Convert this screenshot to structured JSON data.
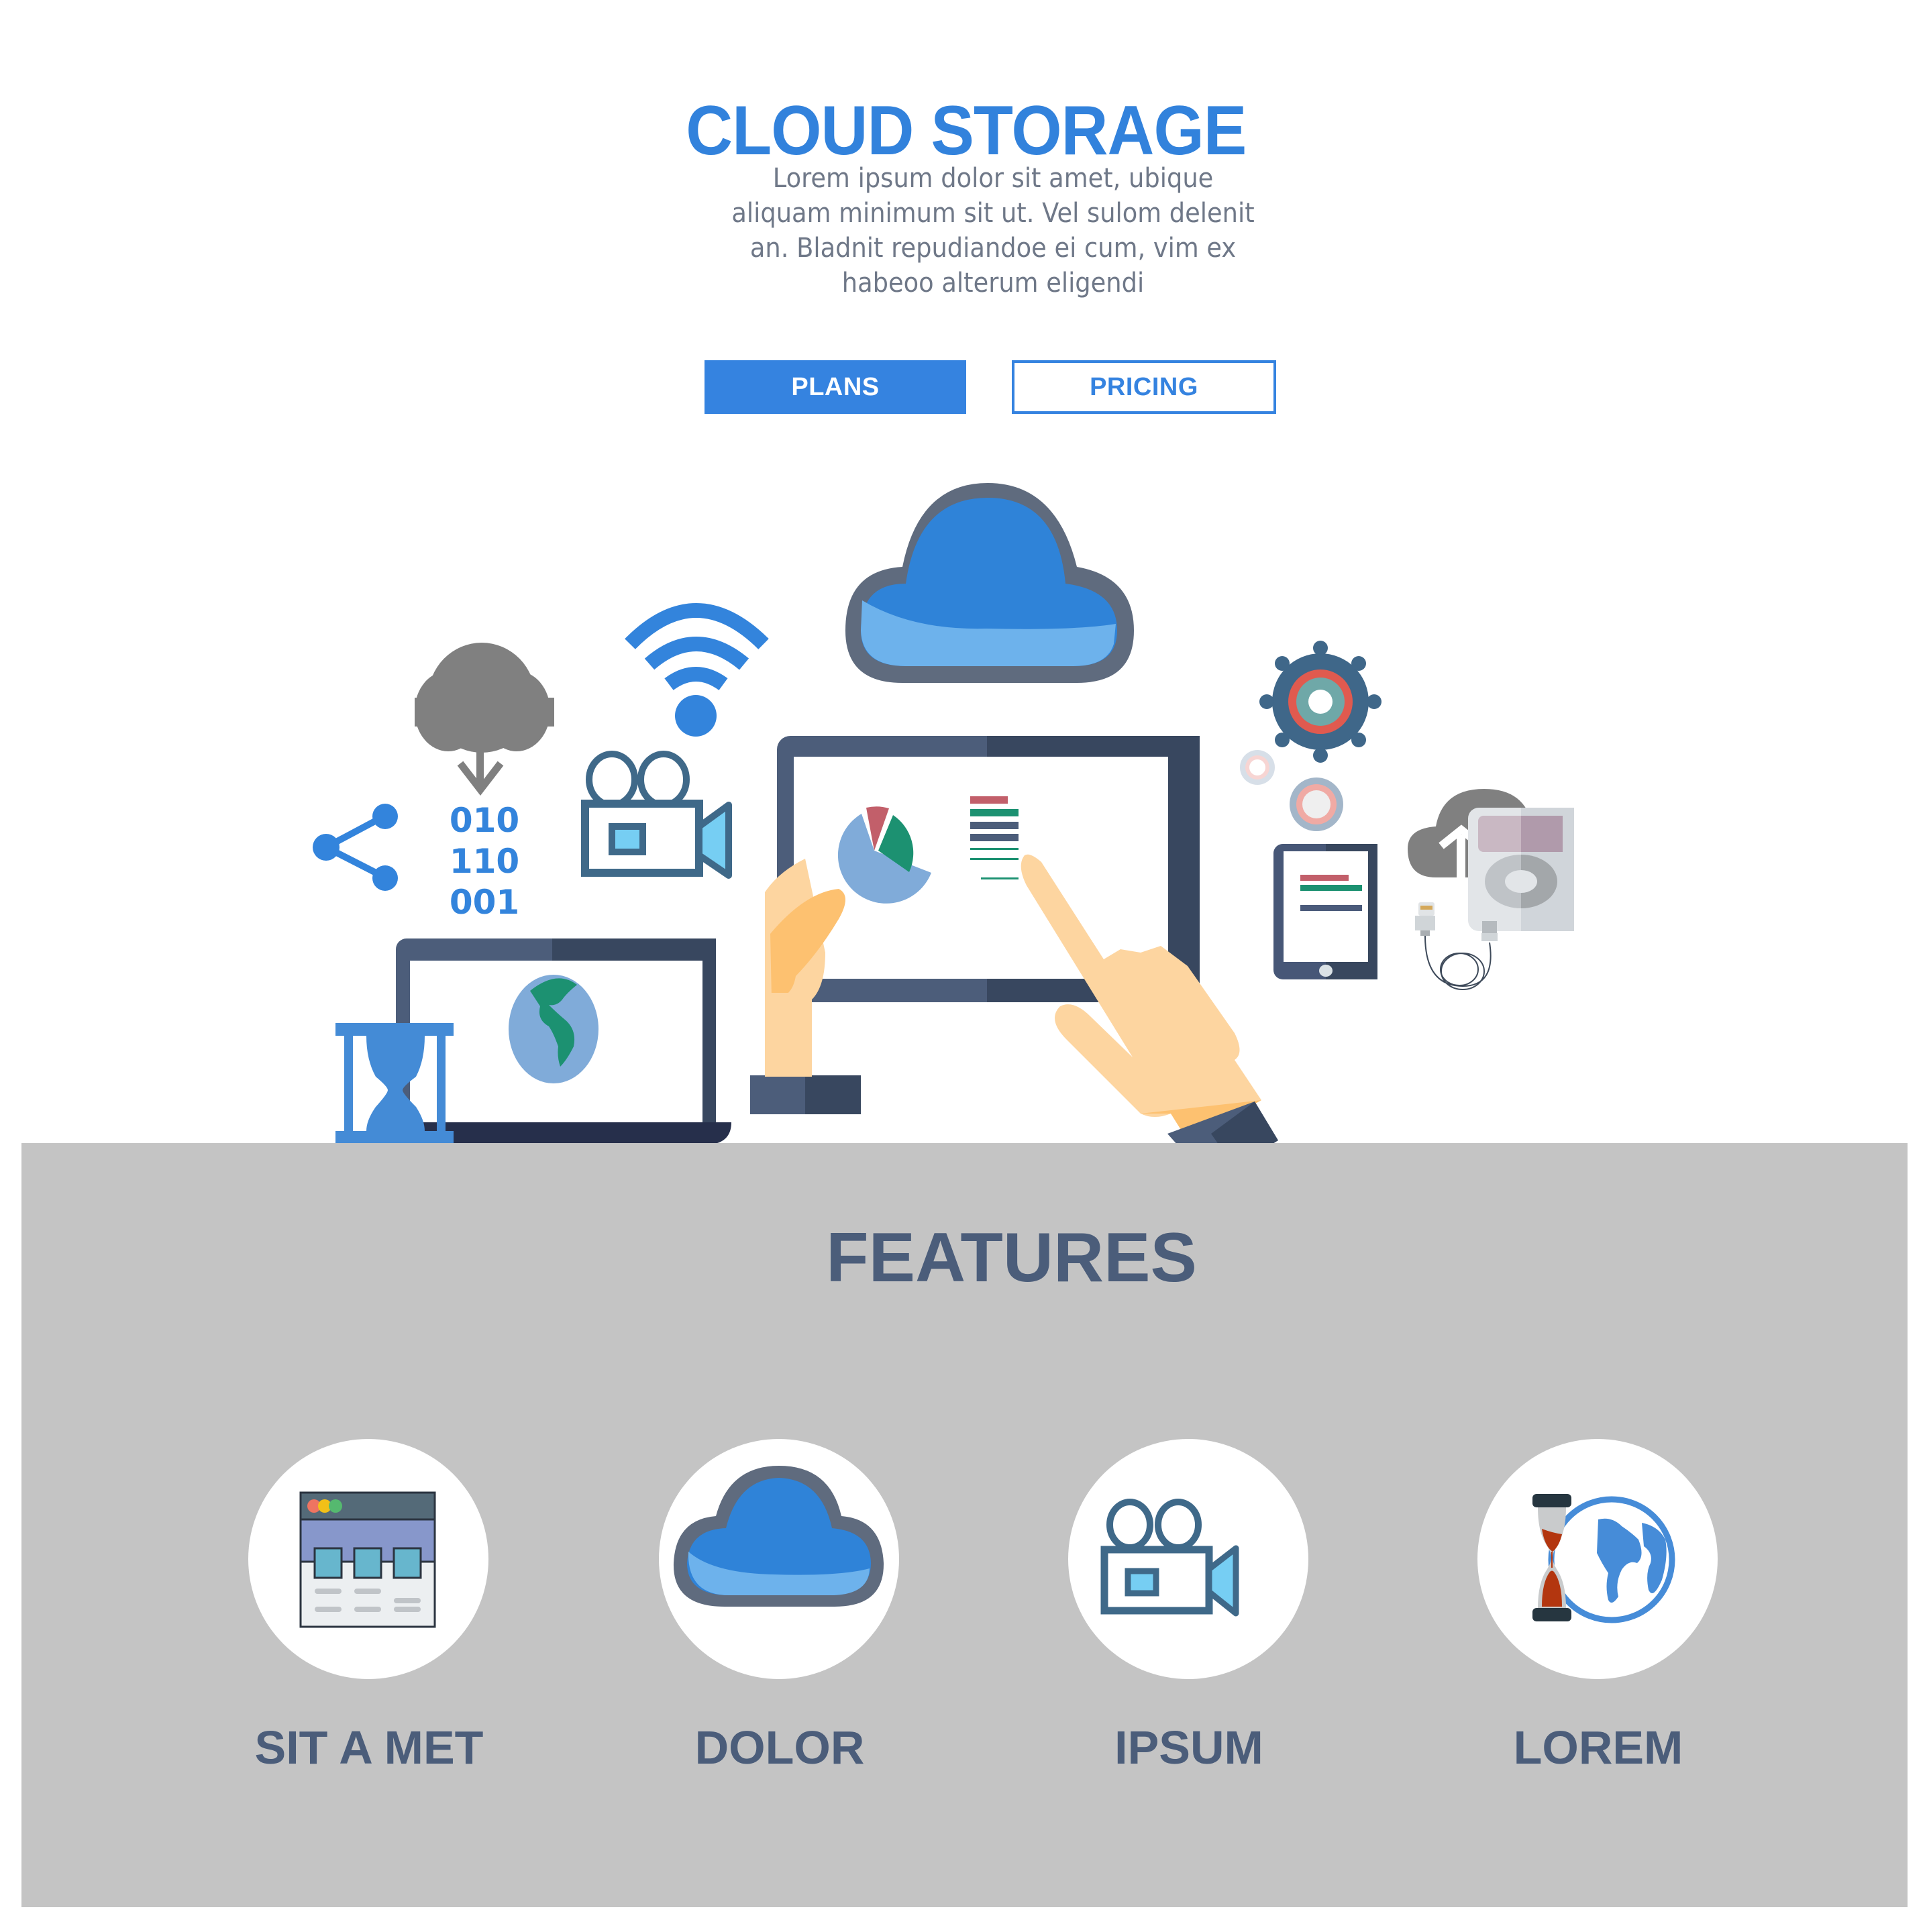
{
  "hero": {
    "title": "CLOUD STORAGE",
    "description": "Lorem ipsum dolor sit amet, ubique aliquam minimum sit ut. Vel sulom delenit an. Bladnit repudiandoe ei cum, vim ex habeoo alterum eligendi"
  },
  "buttons": {
    "plans_label": "PLANS",
    "pricing_label": "PRICING"
  },
  "illustration": {
    "binary_lines": [
      "010",
      "110",
      "001"
    ],
    "icons": [
      "cloud-download-icon",
      "share-icon",
      "binary-code-icon",
      "wifi-icon",
      "video-camera-icon",
      "cloud-icon",
      "gear-icon",
      "tablet-chart-icon",
      "pointing-hand-icon",
      "laptop-globe-icon",
      "hourglass-icon",
      "smartphone-icon",
      "cloud-upload-icon",
      "music-player-icon",
      "usb-cable-icon"
    ]
  },
  "features": {
    "title": "FEATURES",
    "items": [
      {
        "label": "SIT A MET",
        "icon": "browser-window-icon"
      },
      {
        "label": "DOLOR",
        "icon": "cloud-icon"
      },
      {
        "label": "IPSUM",
        "icon": "video-camera-icon"
      },
      {
        "label": "LOREM",
        "icon": "hourglass-globe-icon"
      }
    ]
  },
  "colors": {
    "accent": "#3583e0",
    "heading_dark": "#4b5d7a",
    "panel_gray": "#c4c4c4",
    "body_text": "#6f7888"
  }
}
